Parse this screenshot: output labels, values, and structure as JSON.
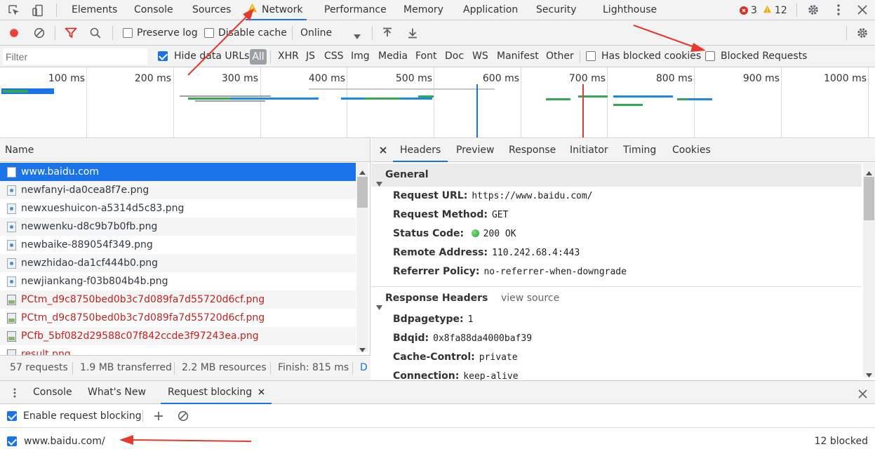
{
  "top_tabs": [
    "Elements",
    "Console",
    "Sources",
    "Network",
    "Performance",
    "Memory",
    "Application",
    "Security",
    "Lighthouse"
  ],
  "active_tab": "Network",
  "counters": {
    "errors": "3",
    "warnings": "12"
  },
  "toolbar": {
    "preserve_log": "Preserve log",
    "disable_cache": "Disable cache",
    "throttle": "Online"
  },
  "filter": {
    "placeholder": "Filter",
    "hide_data_urls": "Hide data URLs",
    "types": [
      "All",
      "XHR",
      "JS",
      "CSS",
      "Img",
      "Media",
      "Font",
      "Doc",
      "WS",
      "Manifest",
      "Other"
    ],
    "has_blocked_cookies": "Has blocked cookies",
    "blocked_requests": "Blocked Requests"
  },
  "timeline": {
    "labels": [
      "100 ms",
      "200 ms",
      "300 ms",
      "400 ms",
      "500 ms",
      "600 ms",
      "700 ms",
      "800 ms",
      "900 ms",
      "1000 ms"
    ]
  },
  "request_list": {
    "header": "Name",
    "rows": [
      {
        "name": "www.baidu.com",
        "kind": "doc",
        "state": "selected"
      },
      {
        "name": "newfanyi-da0cea8f7e.png",
        "kind": "img",
        "state": "normal"
      },
      {
        "name": "newxueshuicon-a5314d5c83.png",
        "kind": "img",
        "state": "normal"
      },
      {
        "name": "newwenku-d8c9b7b0fb.png",
        "kind": "img",
        "state": "normal"
      },
      {
        "name": "newbaike-889054f349.png",
        "kind": "img",
        "state": "normal"
      },
      {
        "name": "newzhidao-da1cf444b0.png",
        "kind": "img",
        "state": "normal"
      },
      {
        "name": "newjiankang-f03b804b4b.png",
        "kind": "img",
        "state": "normal"
      },
      {
        "name": "PCtm_d9c8750bed0b3c7d089fa7d55720d6cf.png",
        "kind": "broken",
        "state": "error"
      },
      {
        "name": "PCtm_d9c8750bed0b3c7d089fa7d55720d6cf.png",
        "kind": "broken",
        "state": "error"
      },
      {
        "name": "PCfb_5bf082d29588c07f842ccde3f97243ea.png",
        "kind": "broken",
        "state": "error"
      },
      {
        "name": "result.png",
        "kind": "broken",
        "state": "error"
      }
    ]
  },
  "status_bar": {
    "requests": "57 requests",
    "transferred": "1.9 MB transferred",
    "resources": "2.2 MB resources",
    "finish": "Finish: 815 ms",
    "more": "D"
  },
  "details": {
    "tabs": [
      "Headers",
      "Preview",
      "Response",
      "Initiator",
      "Timing",
      "Cookies"
    ],
    "active": "Headers",
    "general": {
      "title": "General",
      "items": [
        {
          "key": "Request URL:",
          "value": "https://www.baidu.com/"
        },
        {
          "key": "Request Method:",
          "value": "GET"
        },
        {
          "key": "Status Code:",
          "value": "200 OK"
        },
        {
          "key": "Remote Address:",
          "value": "110.242.68.4:443"
        },
        {
          "key": "Referrer Policy:",
          "value": "no-referrer-when-downgrade"
        }
      ]
    },
    "response_headers": {
      "title": "Response Headers",
      "view_source": "view source",
      "items": [
        {
          "key": "Bdpagetype:",
          "value": "1"
        },
        {
          "key": "Bdqid:",
          "value": "0x8fa88da4000baf39"
        },
        {
          "key": "Cache-Control:",
          "value": "private"
        },
        {
          "key": "Connection:",
          "value": "keep-alive"
        }
      ]
    }
  },
  "drawer": {
    "tabs": [
      "Console",
      "What's New",
      "Request blocking"
    ],
    "active": "Request blocking",
    "enable_label": "Enable request blocking",
    "patterns": [
      {
        "pattern": "www.baidu.com/",
        "count": "12 blocked"
      }
    ]
  },
  "colors": {
    "accent": "#1a73e8",
    "error_text": "#c5221f",
    "record": "#ea4335",
    "annotation_arrow": "#e8392e"
  }
}
